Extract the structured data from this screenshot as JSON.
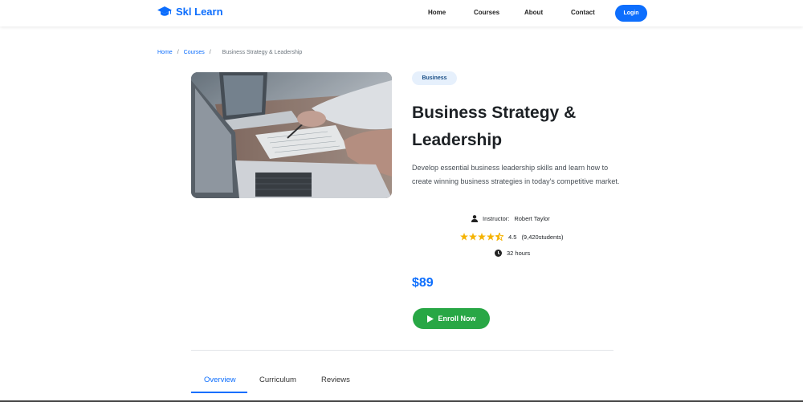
{
  "header": {
    "brand": "Skl Learn",
    "nav": [
      "Home",
      "Courses",
      "About",
      "Contact"
    ],
    "login_label": "Login"
  },
  "breadcrumb": {
    "home": "Home",
    "courses": "Courses",
    "current": "Business Strategy & Leadership",
    "separator": "/"
  },
  "course": {
    "badge": "Business",
    "title": "Business Strategy & Leadership",
    "description": "Develop essential business leadership skills and learn how to create winning business strategies in today's competitive market.",
    "instructor_label": "Instructor:",
    "instructor": "Robert Taylor",
    "rating": "4.5",
    "rating_value": 4.5,
    "students": "(9,420students)",
    "duration": "32 hours",
    "price": "$89",
    "enroll_label": "Enroll Now"
  },
  "tabs": [
    "Overview",
    "Curriculum",
    "Reviews"
  ],
  "colors": {
    "primary": "#0d6efd",
    "success": "#28a745",
    "star": "#f5b301",
    "badge_bg": "#e6f0fc"
  },
  "icons": [
    "graduation-cap-icon",
    "user-icon",
    "star-icon",
    "clock-icon",
    "play-icon"
  ]
}
